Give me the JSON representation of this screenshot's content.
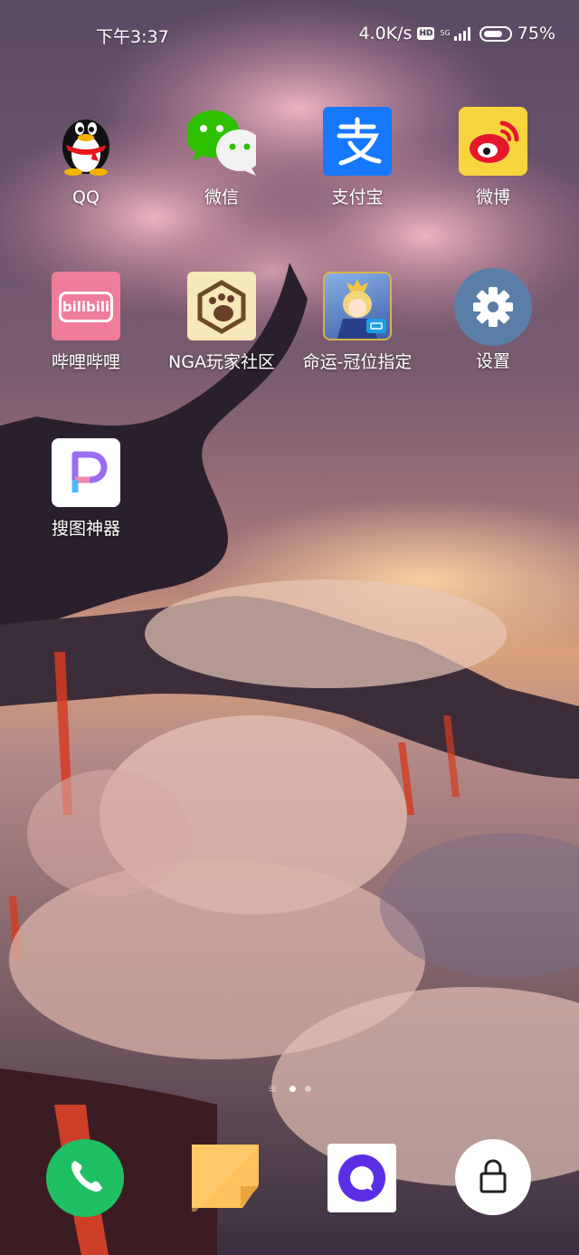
{
  "status_bar": {
    "time": "下午3:37",
    "net_speed": "4.0K/s",
    "hd_badge": "HD",
    "network_type": "5G",
    "battery_percent": "75%",
    "battery_level": 0.75,
    "icons": [
      "hd-icon",
      "signal-icon",
      "battery-icon"
    ]
  },
  "home_apps": [
    {
      "label": "QQ",
      "icon": "qq-penguin-icon"
    },
    {
      "label": "微信",
      "icon": "wechat-icon"
    },
    {
      "label": "支付宝",
      "icon": "alipay-icon"
    },
    {
      "label": "微博",
      "icon": "weibo-icon"
    },
    {
      "label": "哔哩哔哩",
      "icon": "bilibili-icon",
      "icon_text": "bilibili"
    },
    {
      "label": "NGA玩家社区",
      "icon": "nga-icon"
    },
    {
      "label": "命运-冠位指定",
      "icon": "fate-grand-order-icon"
    },
    {
      "label": "设置",
      "icon": "settings-gear-icon"
    },
    {
      "label": "搜图神器",
      "icon": "soutu-icon"
    }
  ],
  "page_indicator": {
    "pages": 2,
    "active": 0
  },
  "dock": [
    {
      "name": "phone",
      "icon": "phone-icon"
    },
    {
      "name": "notes",
      "icon": "notes-icon"
    },
    {
      "name": "messages",
      "icon": "messages-icon"
    },
    {
      "name": "lock-screen",
      "icon": "lock-icon"
    }
  ],
  "colors": {
    "alipay_blue": "#1677ff",
    "wechat_green": "#2dc100",
    "bilibili_pink": "#f07c9b",
    "phone_green": "#1fc063",
    "notes_orange": "#ffc25c",
    "messages_purple": "#5b2ee6",
    "settings_blue": "#5b7ea8"
  }
}
